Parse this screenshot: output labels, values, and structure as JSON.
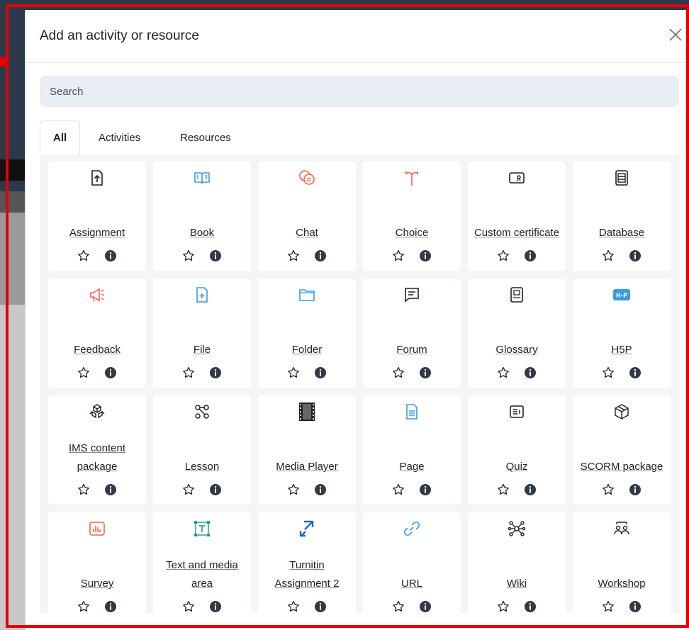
{
  "modal": {
    "title": "Add an activity or resource",
    "close_icon": "close-icon"
  },
  "search": {
    "placeholder": "Search"
  },
  "tabs": [
    {
      "label": "All",
      "active": true
    },
    {
      "label": "Activities",
      "active": false
    },
    {
      "label": "Resources",
      "active": false
    }
  ],
  "colors": {
    "assessment": "#f7634d",
    "collaboration": "#f7634d",
    "content": "#399be2",
    "communication": "#11a676",
    "interactive": "#5b40ff",
    "default": "#1d2125",
    "frame": "#e40000"
  },
  "items": [
    {
      "name": "Assignment",
      "icon": "assignment-upload-icon"
    },
    {
      "name": "Book",
      "icon": "book-icon"
    },
    {
      "name": "Chat",
      "icon": "chat-icon"
    },
    {
      "name": "Choice",
      "icon": "choice-icon"
    },
    {
      "name": "Custom certificate",
      "icon": "certificate-icon"
    },
    {
      "name": "Database",
      "icon": "database-icon"
    },
    {
      "name": "Feedback",
      "icon": "megaphone-icon"
    },
    {
      "name": "File",
      "icon": "file-icon"
    },
    {
      "name": "Folder",
      "icon": "folder-icon"
    },
    {
      "name": "Forum",
      "icon": "forum-icon"
    },
    {
      "name": "Glossary",
      "icon": "glossary-icon"
    },
    {
      "name": "H5P",
      "icon": "h5p-icon"
    },
    {
      "name": "IMS content package",
      "icon": "ims-package-icon"
    },
    {
      "name": "Lesson",
      "icon": "lesson-icon"
    },
    {
      "name": "Media Player",
      "icon": "film-icon"
    },
    {
      "name": "Page",
      "icon": "page-icon"
    },
    {
      "name": "Quiz",
      "icon": "quiz-icon"
    },
    {
      "name": "SCORM package",
      "icon": "scorm-icon"
    },
    {
      "name": "Survey",
      "icon": "survey-icon"
    },
    {
      "name": "Text and media area",
      "icon": "text-media-icon"
    },
    {
      "name": "Turnitin Assignment 2",
      "icon": "turnitin-icon"
    },
    {
      "name": "URL",
      "icon": "link-icon"
    },
    {
      "name": "Wiki",
      "icon": "wiki-icon"
    },
    {
      "name": "Workshop",
      "icon": "workshop-icon"
    }
  ]
}
